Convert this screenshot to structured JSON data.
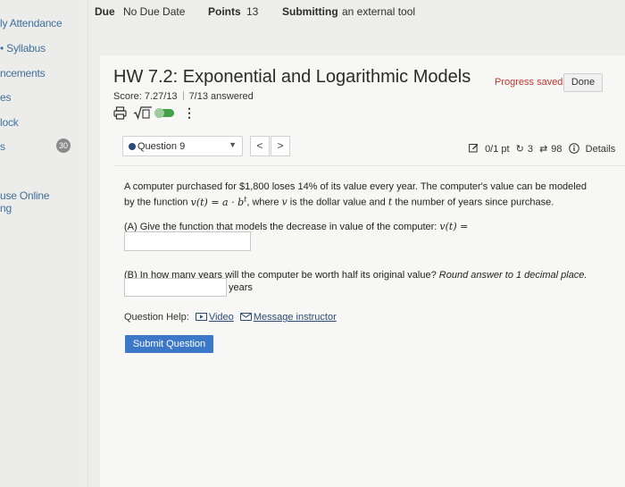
{
  "sidebar": {
    "items": [
      {
        "label": "ly Attendance"
      },
      {
        "label": "Syllabus"
      },
      {
        "label": "ncements"
      },
      {
        "label": "es"
      },
      {
        "label": "lock"
      },
      {
        "label": "s"
      },
      {
        "label": "use Online"
      },
      {
        "label": "ng"
      }
    ],
    "badge": "30"
  },
  "topbar": {
    "due_label": "Due",
    "due_value": "No Due Date",
    "points_label": "Points",
    "points_value": "13",
    "submitting_label": "Submitting",
    "submitting_value": "an external tool"
  },
  "assignment": {
    "title": "HW 7.2: Exponential and Logarithmic Models",
    "progress": "Progress saved",
    "done": "Done",
    "score": "Score: 7.27/13",
    "answered": "7/13 answered"
  },
  "question_nav": {
    "current": "Question 9",
    "prev": "<",
    "next": ">",
    "points": "0/1 pt",
    "retries": "3",
    "attempts": "98",
    "details": "Details"
  },
  "question": {
    "text_1": "A computer purchased for $1,800 loses 14% of its value every year. The computer's value can be modeled",
    "text_2a": "by the function ",
    "text_2b": ", where ",
    "text_2c": " is the dollar value and ",
    "text_2d": " the number of years since purchase.",
    "math_func": "v(t) = a · b",
    "math_exp": "t",
    "var_v": "v",
    "var_t": "t",
    "part_a": "(A) Give the function that models the decrease in value of the computer: ",
    "part_a_math": "v(t) =",
    "part_b": "(B) In how many years will the computer be worth half its original value? ",
    "part_b_italic": "Round answer to 1 decimal place.",
    "units": "years",
    "help_label": "Question Help:",
    "video": "Video",
    "message": "Message instructor",
    "submit": "Submit Question"
  },
  "colors": {
    "accent": "#3b78c7",
    "toggle": "#43a047",
    "progress": "#c0392b"
  }
}
